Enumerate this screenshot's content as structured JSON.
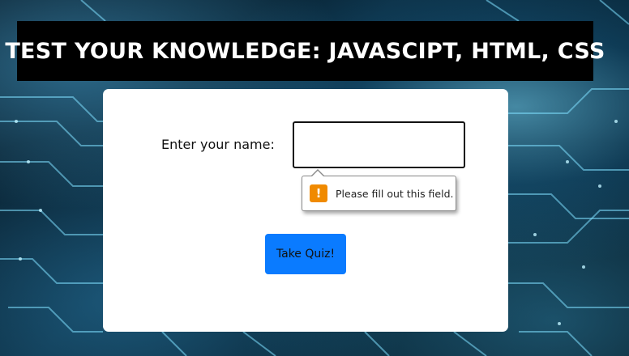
{
  "header": {
    "title": "TEST YOUR KNOWLEDGE: JAVASCIPT, HTML, CSS"
  },
  "form": {
    "name_label": "Enter your name:",
    "name_value": "",
    "validation_message": "Please fill out this field.",
    "warning_icon_glyph": "!",
    "submit_label": "Take Quiz!"
  },
  "colors": {
    "title_bg": "#000000",
    "button_bg": "#0a7bff",
    "warning": "#f08a00"
  },
  "icons": {
    "validation": "warning-icon"
  }
}
